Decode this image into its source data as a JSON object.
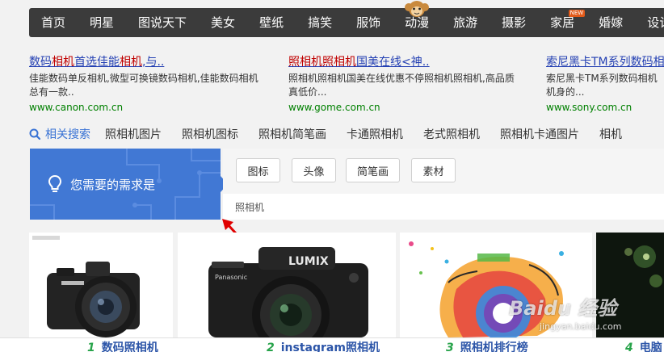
{
  "nav": {
    "items": [
      "首页",
      "明星",
      "图说天下",
      "美女",
      "壁纸",
      "搞笑",
      "服饰",
      "动漫",
      "旅游",
      "摄影",
      "家居",
      "婚嫁",
      "设计"
    ],
    "new_badge": "NEW"
  },
  "ads": [
    {
      "title_parts": [
        "数码",
        "相机",
        "首选佳能",
        "相机",
        ",与.."
      ],
      "desc": "佳能数码单反相机,微型可换镜数码相机,佳能数码相机总有一款..",
      "url": "www.canon.com.cn"
    },
    {
      "title_parts": [
        "照相机照相机",
        "国美在线<神.."
      ],
      "desc": "照相机照相机国美在线优惠不停照相机照相机,高品质真低价...",
      "url": "www.gome.com.cn"
    },
    {
      "title_parts": [
        "索尼黑卡TM系列数码相"
      ],
      "desc": "索尼黑卡TM系列数码相机机身的...",
      "url": "www.sony.com.cn"
    }
  ],
  "related": {
    "lead": "相关搜索",
    "keywords": [
      "照相机图片",
      "照相机图标",
      "照相机简笔画",
      "卡通照相机",
      "老式照相机",
      "照相机卡通图片",
      "相机"
    ]
  },
  "need": {
    "label": "您需要的需求是",
    "tags": [
      "图标",
      "头像",
      "简笔画",
      "素材"
    ],
    "query": "照相机"
  },
  "bottom": [
    {
      "num": "1",
      "text": "数码照相机"
    },
    {
      "num": "2",
      "text": "instagram照相机"
    },
    {
      "num": "3",
      "text": "照相机排行榜"
    },
    {
      "num": "4",
      "text": "电脑"
    }
  ],
  "watermark": {
    "text": "Baidu 经验",
    "sub": "jingyan.baidu.com"
  },
  "colors": {
    "nav_bg": "#3b3b3b",
    "accent_blue": "#4178d4",
    "link": "#2440b3",
    "highlight": "#c00000",
    "url_green": "#008000",
    "annotation_red": "#e00000"
  }
}
